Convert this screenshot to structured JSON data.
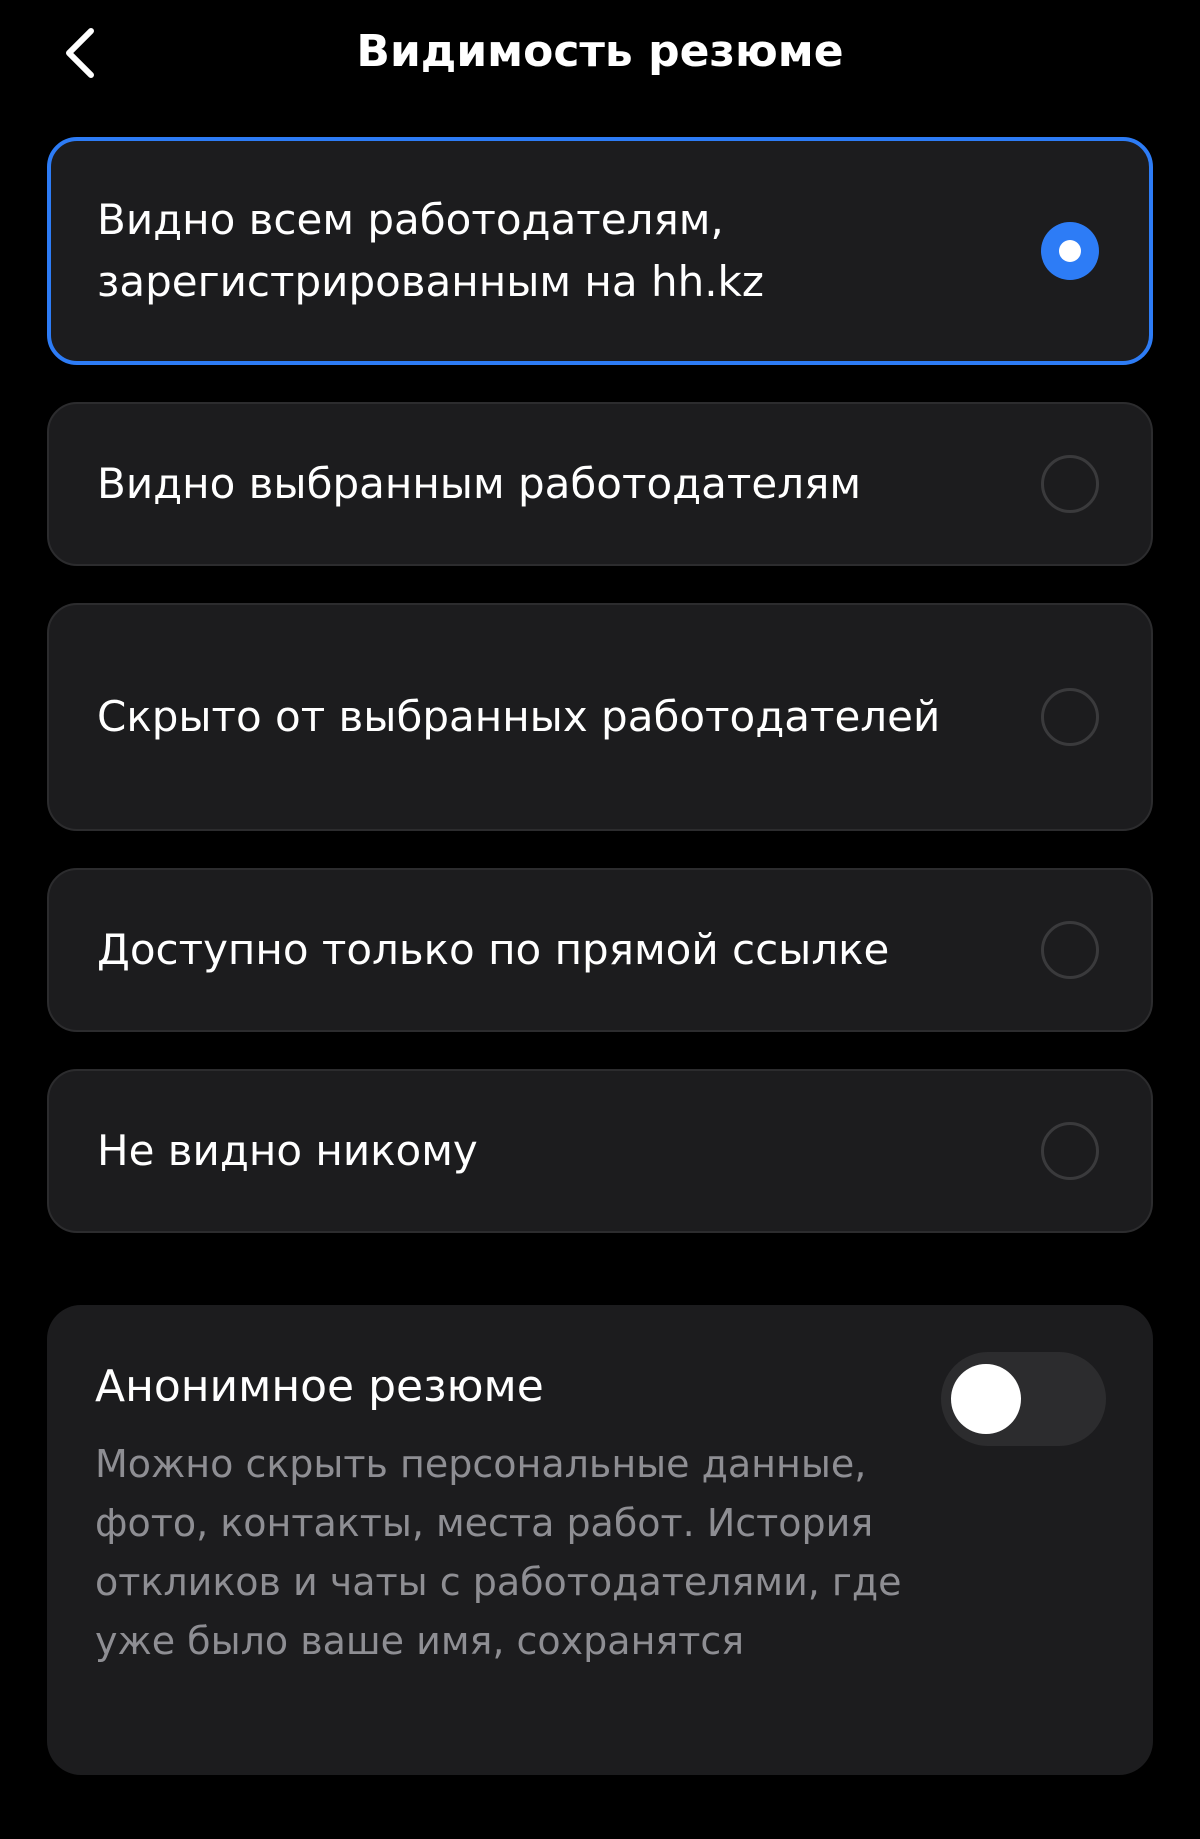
{
  "header": {
    "title": "Видимость резюме",
    "back_icon": "chevron-left-icon"
  },
  "visibility_options": [
    {
      "label": "Видно всем работодателям, зарегистрированным на hh.kz",
      "selected": true
    },
    {
      "label": "Видно выбранным работодателям",
      "selected": false
    },
    {
      "label": "Скрыто от выбранных работодателей",
      "selected": false
    },
    {
      "label": "Доступно только по прямой ссылке",
      "selected": false
    },
    {
      "label": "Не видно никому",
      "selected": false
    }
  ],
  "anonymous": {
    "title": "Анонимное резюме",
    "description": "Можно скрыть персональные данные, фото, контакты, места работ. История откликов и чаты с работодателями, где уже было ваше имя, сохранятся",
    "enabled": false
  },
  "colors": {
    "accent": "#2d7cf6",
    "background": "#000000",
    "card": "#1c1c1e",
    "secondary_text": "#8e8e93"
  }
}
